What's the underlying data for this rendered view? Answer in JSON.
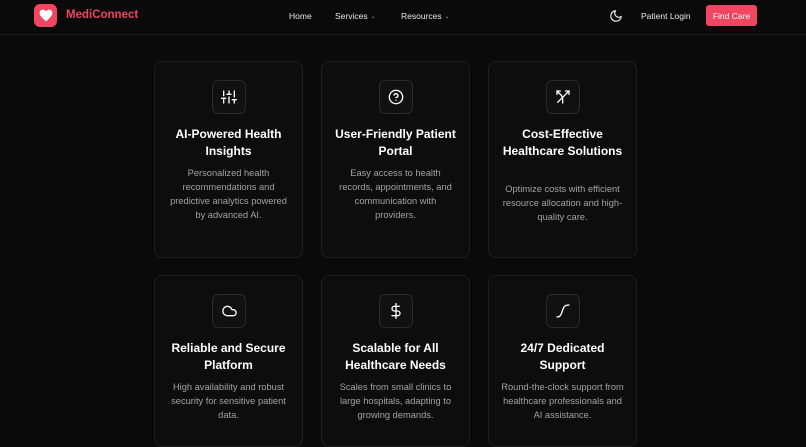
{
  "nav": {
    "brand": "MediConnect",
    "links": [
      {
        "label": "Home"
      },
      {
        "label": "Services"
      },
      {
        "label": "Resources"
      }
    ],
    "login_label": "Patient Login",
    "cta_label": "Find Care"
  },
  "colors": {
    "accent": "#f0465f",
    "background": "#0a0a0a",
    "card_border": "#1e1e1e"
  },
  "features": [
    {
      "icon": "sliders-icon",
      "title": "AI-Powered Health Insights",
      "description": "Personalized health recommendations and predictive analytics powered by advanced AI."
    },
    {
      "icon": "question-circle-icon",
      "title": "User-Friendly Patient Portal",
      "description": "Easy access to health records, appointments, and communication with providers."
    },
    {
      "icon": "split-arrows-icon",
      "title": "Cost-Effective Healthcare Solutions",
      "description": "Optimize costs with efficient resource allocation and high-quality care."
    },
    {
      "icon": "cloud-icon",
      "title": "Reliable and Secure Platform",
      "description": "High availability and robust security for sensitive patient data."
    },
    {
      "icon": "dollar-icon",
      "title": "Scalable for All Healthcare Needs",
      "description": "Scales from small clinics to large hospitals, adapting to growing demands."
    },
    {
      "icon": "curve-icon",
      "title": "24/7 Dedicated Support",
      "description": "Round-the-clock support from healthcare professionals and AI assistance."
    }
  ]
}
